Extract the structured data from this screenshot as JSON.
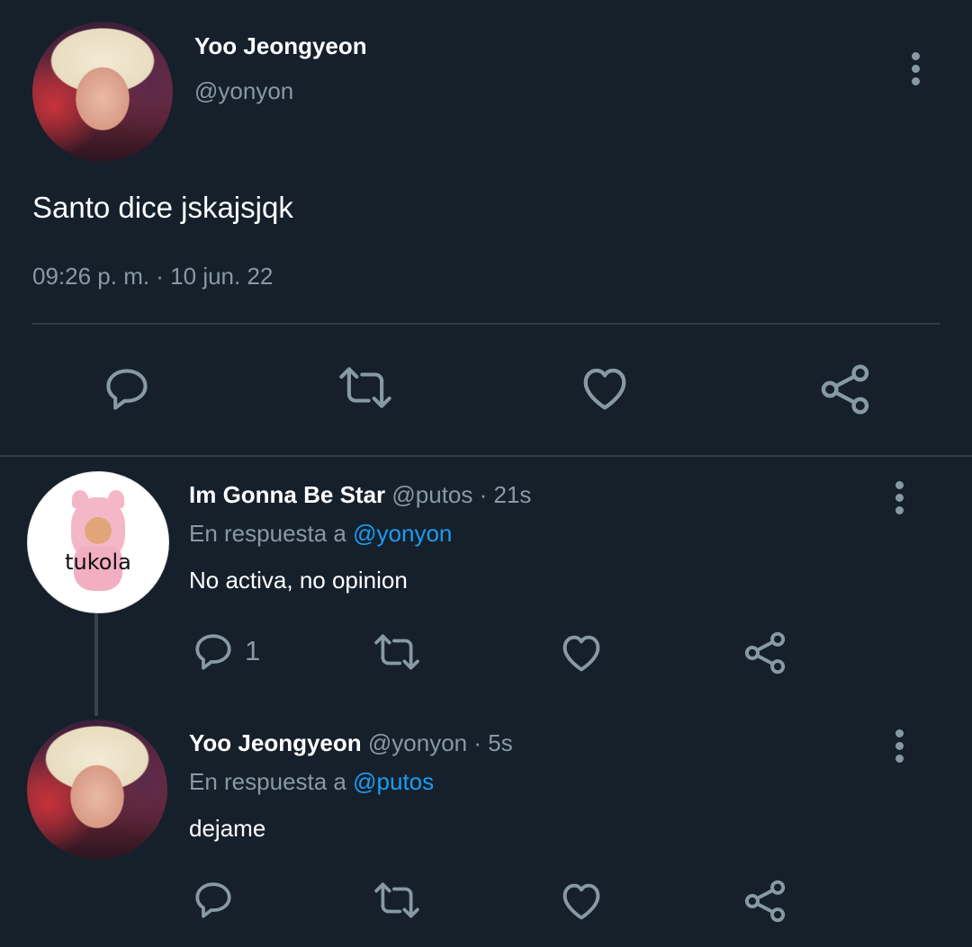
{
  "main_tweet": {
    "name": "Yoo Jeongyeon",
    "handle": "@yonyon",
    "text": "Santo dice jskajsjqk",
    "timestamp": "09:26 p. m. · 10 jun. 22",
    "actions": [
      "reply-icon",
      "retweet-icon",
      "like-icon",
      "share-icon"
    ]
  },
  "replies": [
    {
      "name": "Im Gonna Be Star",
      "handle": "@putos",
      "time": "· 21s",
      "reply_prefix": "En respuesta a",
      "reply_to": "@yonyon",
      "text": "No activa, no opinion",
      "reply_count": "1",
      "avatar_text": "tukola"
    },
    {
      "name": "Yoo Jeongyeon",
      "handle": "@yonyon",
      "time": "· 5s",
      "reply_prefix": "En respuesta a",
      "reply_to": "@putos",
      "text": "dejame",
      "reply_count": ""
    }
  ],
  "colors": {
    "background": "#15202b",
    "muted": "#8899a6",
    "link": "#1d9bf0",
    "divider": "#2f3b47"
  }
}
